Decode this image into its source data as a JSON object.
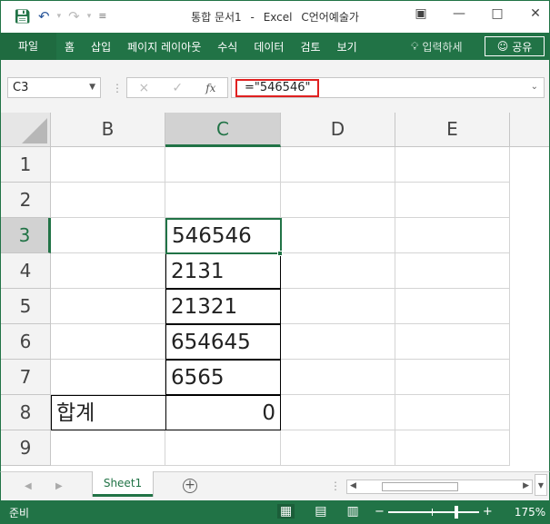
{
  "titlebar": {
    "save_icon": "save-icon",
    "undo_icon": "undo-icon",
    "redo_icon": "redo-icon",
    "customize_icon": "customize-qat-icon",
    "doc_name": "통합 문서1",
    "separator": "-",
    "app_name": "Excel",
    "user": "C언어예술가",
    "ribbon_display_icon": "ribbon-display-icon",
    "minimize_icon": "minimize-icon",
    "maximize_icon": "maximize-icon",
    "close_icon": "close-icon"
  },
  "ribbon": {
    "file_tab": "파일",
    "tabs": [
      "홈",
      "삽입",
      "페이지 레이아웃",
      "수식",
      "데이터",
      "검토",
      "보기"
    ],
    "tell_me": "입력하세",
    "share": "공유"
  },
  "formula_bar": {
    "name_box": "C3",
    "cancel_icon": "×",
    "enter_icon": "✓",
    "fx_label": "fx",
    "formula": "=\"546546\""
  },
  "grid": {
    "columns": [
      "B",
      "C",
      "D",
      "E"
    ],
    "active_column": "C",
    "rows": [
      "1",
      "2",
      "3",
      "4",
      "5",
      "6",
      "7",
      "8",
      "9"
    ],
    "active_row": "3",
    "cells": {
      "C3": "546546",
      "C4": "2131",
      "C5": "21321",
      "C6": "654645",
      "C7": "6565",
      "B8": "합계",
      "C8": "0"
    }
  },
  "sheets": {
    "tabs": [
      "Sheet1"
    ],
    "active": "Sheet1",
    "add_label": "+"
  },
  "status": {
    "ready": "준비",
    "zoom_minus": "−",
    "zoom_plus": "+",
    "zoom_percent": "175%"
  },
  "colors": {
    "accent": "#217346",
    "highlight_box": "#e02020"
  }
}
